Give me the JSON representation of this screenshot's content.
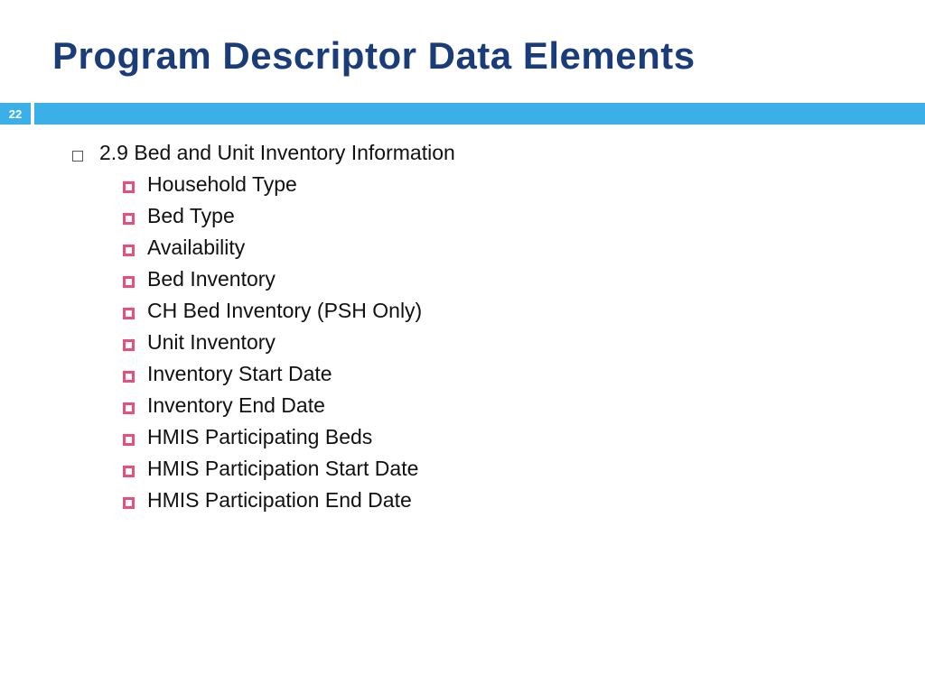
{
  "slide": {
    "title": "Program Descriptor Data Elements",
    "pageNumber": "22",
    "mainBullet": "2.9 Bed and Unit Inventory Information",
    "subBullets": [
      "Household Type",
      "Bed Type",
      "Availability",
      "Bed Inventory",
      "CH Bed Inventory (PSH Only)",
      "Unit Inventory",
      "Inventory Start Date",
      "Inventory End Date",
      "HMIS Participating Beds",
      "HMIS Participation Start Date",
      "HMIS Participation End Date"
    ]
  }
}
